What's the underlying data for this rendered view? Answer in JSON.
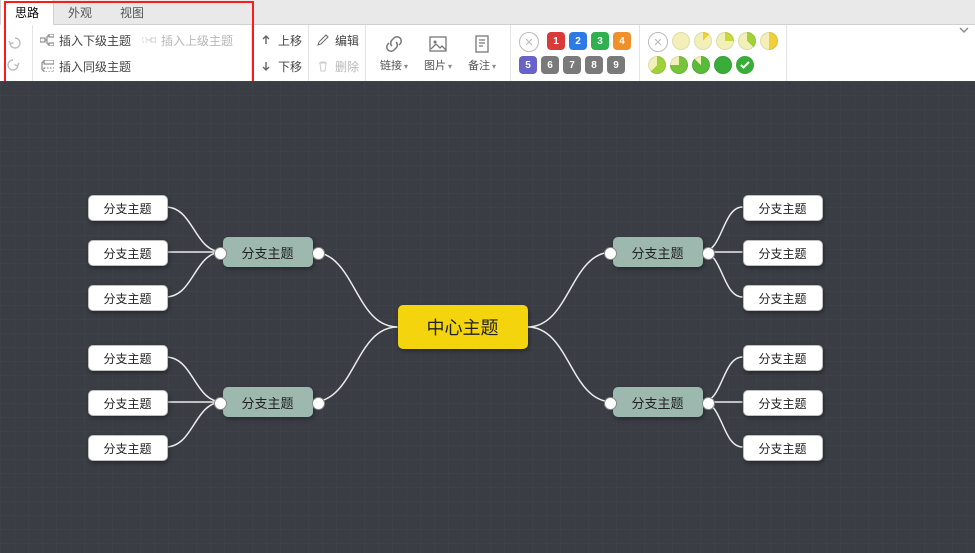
{
  "tabs": {
    "t0": "思路",
    "t1": "外观",
    "t2": "视图"
  },
  "insert": {
    "child": "插入下级主题",
    "parent": "插入上级主题",
    "sibling": "插入同级主题"
  },
  "move": {
    "up": "上移",
    "down": "下移"
  },
  "edit": {
    "edit": "编辑",
    "del": "删除"
  },
  "tools": {
    "link": "链接",
    "image": "图片",
    "note": "备注"
  },
  "badges": {
    "row1": [
      {
        "n": "1",
        "c": "#d93a3a"
      },
      {
        "n": "2",
        "c": "#2c7be5"
      },
      {
        "n": "3",
        "c": "#2fb14d"
      },
      {
        "n": "4",
        "c": "#f0902b"
      }
    ],
    "row2": [
      {
        "n": "5",
        "c": "#6a63c7"
      },
      {
        "n": "6",
        "c": "#7a7a7a"
      },
      {
        "n": "7",
        "c": "#7a7a7a"
      },
      {
        "n": "8",
        "c": "#7a7a7a"
      },
      {
        "n": "9",
        "c": "#7a7a7a"
      }
    ]
  },
  "pies": {
    "row1": [
      {
        "fill": 0,
        "c": "#f2cf3a"
      },
      {
        "fill": 12,
        "c": "#f2cf3a"
      },
      {
        "fill": 25,
        "c": "#c6d93a"
      },
      {
        "fill": 37,
        "c": "#9fd23a"
      },
      {
        "fill": 50,
        "c": "#f2cf3a"
      }
    ],
    "row2": [
      {
        "fill": 62,
        "c": "#9fd23a"
      },
      {
        "fill": 75,
        "c": "#77c43a"
      },
      {
        "fill": 87,
        "c": "#5aba3a"
      },
      {
        "fill": 100,
        "c": "#3aac3a"
      },
      {
        "fill": -1,
        "c": "#3aac3a"
      }
    ]
  },
  "mind": {
    "center": "中心主题",
    "branch": "分支主题",
    "leaf": "分支主题"
  }
}
